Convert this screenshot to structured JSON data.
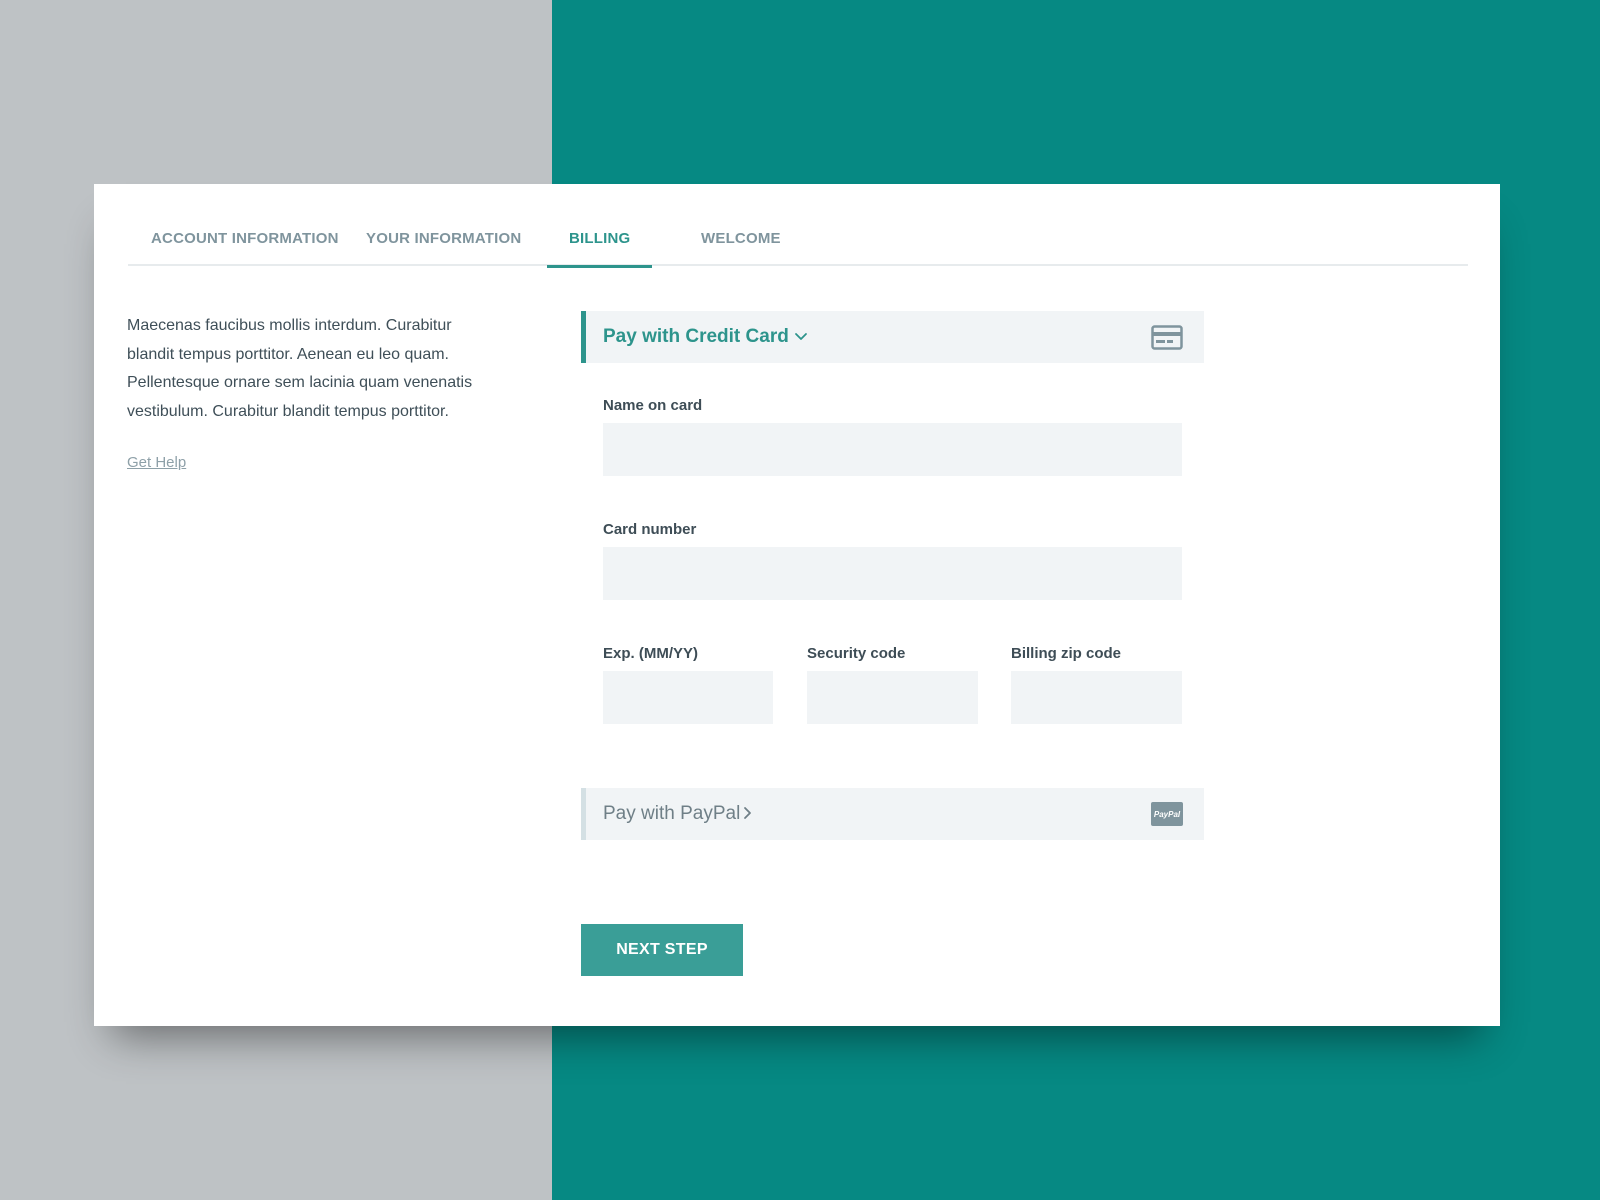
{
  "tabs": [
    {
      "label": "ACCOUNT INFORMATION",
      "active": false
    },
    {
      "label": "YOUR INFORMATION",
      "active": false
    },
    {
      "label": "BILLING",
      "active": true
    },
    {
      "label": "WELCOME",
      "active": false
    }
  ],
  "sidebar": {
    "description": "Maecenas faucibus mollis interdum. Curabitur blandit tempus porttitor. Aenean eu leo quam. Pellentesque ornare sem lacinia quam venenatis vestibulum. Curabitur blandit tempus porttitor.",
    "help_link": "Get Help"
  },
  "credit_card": {
    "title": "Pay with Credit Card",
    "expanded": true,
    "icon": "credit-card-icon",
    "fields": {
      "name_label": "Name on card",
      "name_value": "",
      "number_label": "Card number",
      "number_value": "",
      "exp_label": "Exp. (MM/YY)",
      "exp_value": "",
      "security_label": "Security code",
      "security_value": "",
      "zip_label": "Billing zip code",
      "zip_value": ""
    }
  },
  "paypal": {
    "title": "Pay with PayPal",
    "expanded": false,
    "icon": "paypal-icon",
    "logo_text": "PayPal"
  },
  "actions": {
    "next_label": "NEXT STEP"
  },
  "colors": {
    "accent": "#2d948c",
    "button": "#3a9e97",
    "background_left": "#bec2c5",
    "background_right": "#068983",
    "input_bg": "#f1f4f6",
    "muted_text": "#7f949d"
  }
}
